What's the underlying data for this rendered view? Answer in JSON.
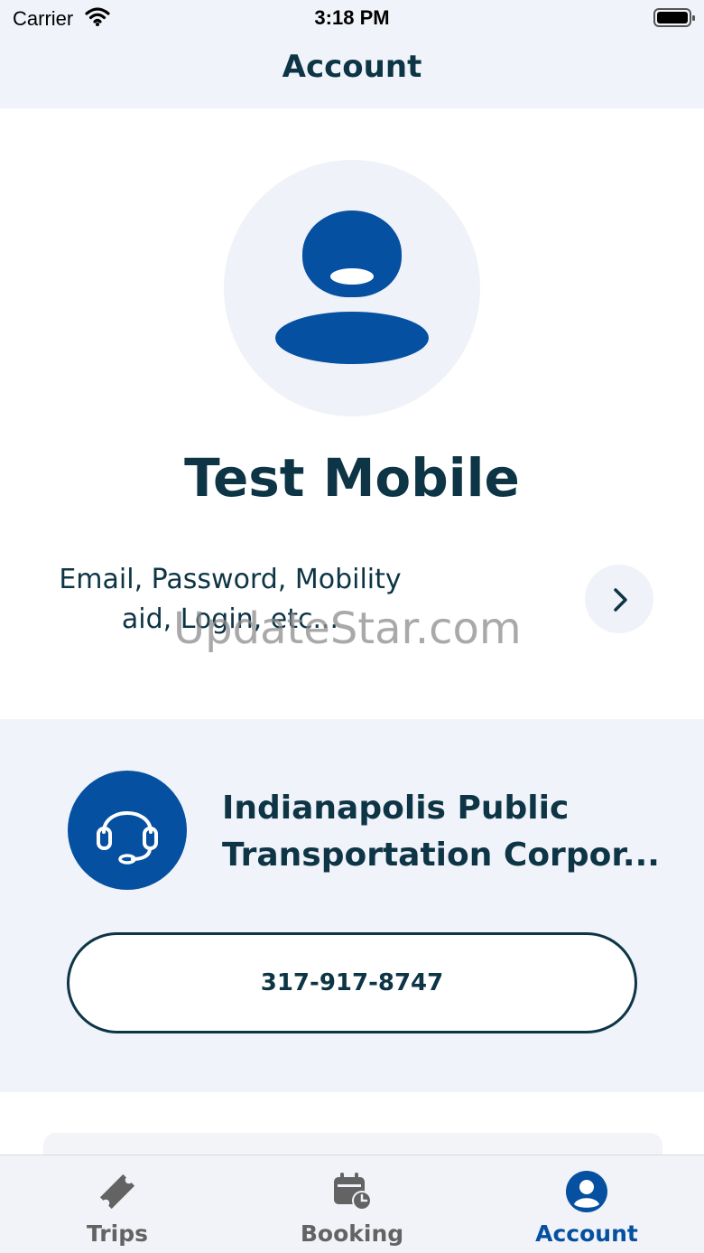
{
  "status_bar": {
    "carrier": "Carrier",
    "time": "3:18 PM"
  },
  "header": {
    "title": "Account"
  },
  "profile": {
    "avatar_icon": "person-avatar-icon",
    "name": "Test Mobile",
    "settings_summary": "Email, Password, Mobility aid, Login, etc...",
    "settings_chevron_icon": "chevron-right-icon"
  },
  "watermark": "UpdateStar.com",
  "agency": {
    "icon": "headset-icon",
    "name": "Indianapolis Public Transportation Corpor...",
    "phone": "317-917-8747"
  },
  "tab_bar": {
    "tabs": [
      {
        "label": "Trips",
        "icon": "ticket-icon",
        "active": false
      },
      {
        "label": "Booking",
        "icon": "calendar-clock-icon",
        "active": false
      },
      {
        "label": "Account",
        "icon": "account-circle-icon",
        "active": true
      }
    ]
  },
  "colors": {
    "primary": "#0550a0",
    "text_dark": "#0d3545",
    "surface_light": "#f1f3fa",
    "tab_inactive": "#636363"
  }
}
